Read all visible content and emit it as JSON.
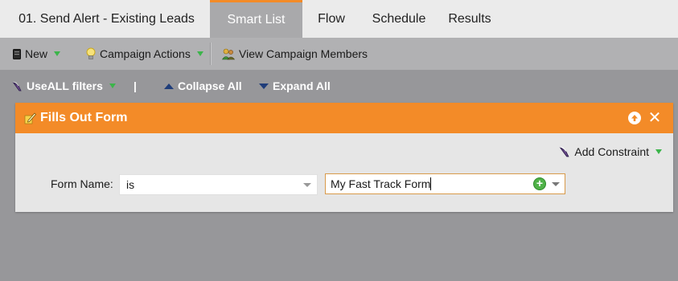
{
  "tabs": {
    "campaign_title": "01. Send Alert - Existing Leads",
    "items": [
      {
        "label": "Smart List",
        "active": true
      },
      {
        "label": "Flow"
      },
      {
        "label": "Schedule"
      },
      {
        "label": "Results"
      }
    ]
  },
  "toolbar": {
    "new_label": "New",
    "campaign_actions_label": "Campaign Actions",
    "view_members_label": "View Campaign Members"
  },
  "filterbar": {
    "use_prefix": "Use ",
    "use_all": "ALL",
    "use_suffix": " filters",
    "separator": "|",
    "collapse_all": "Collapse All",
    "expand_all": "Expand All"
  },
  "filter": {
    "title": "Fills Out Form",
    "add_constraint": "Add Constraint",
    "form_name_label": "Form Name:",
    "operator": "is",
    "value": "My Fast Track Form"
  },
  "colors": {
    "accent_orange": "#f38b28",
    "active_tab": "#a9a9ab",
    "green_caret": "#3bb54a",
    "background": "#97979a"
  },
  "icons": {
    "new": "document-icon",
    "campaign_actions": "lightbulb-icon",
    "view_members": "people-icon",
    "use_filters": "filter-funnel-icon",
    "collapse": "triangle-up-icon",
    "expand": "triangle-down-icon",
    "filter_header": "pencil-form-icon",
    "move_up": "arrow-up-circle-icon",
    "close": "close-icon",
    "add_constraint": "filter-funnel-icon",
    "add_value": "plus-circle-icon"
  }
}
